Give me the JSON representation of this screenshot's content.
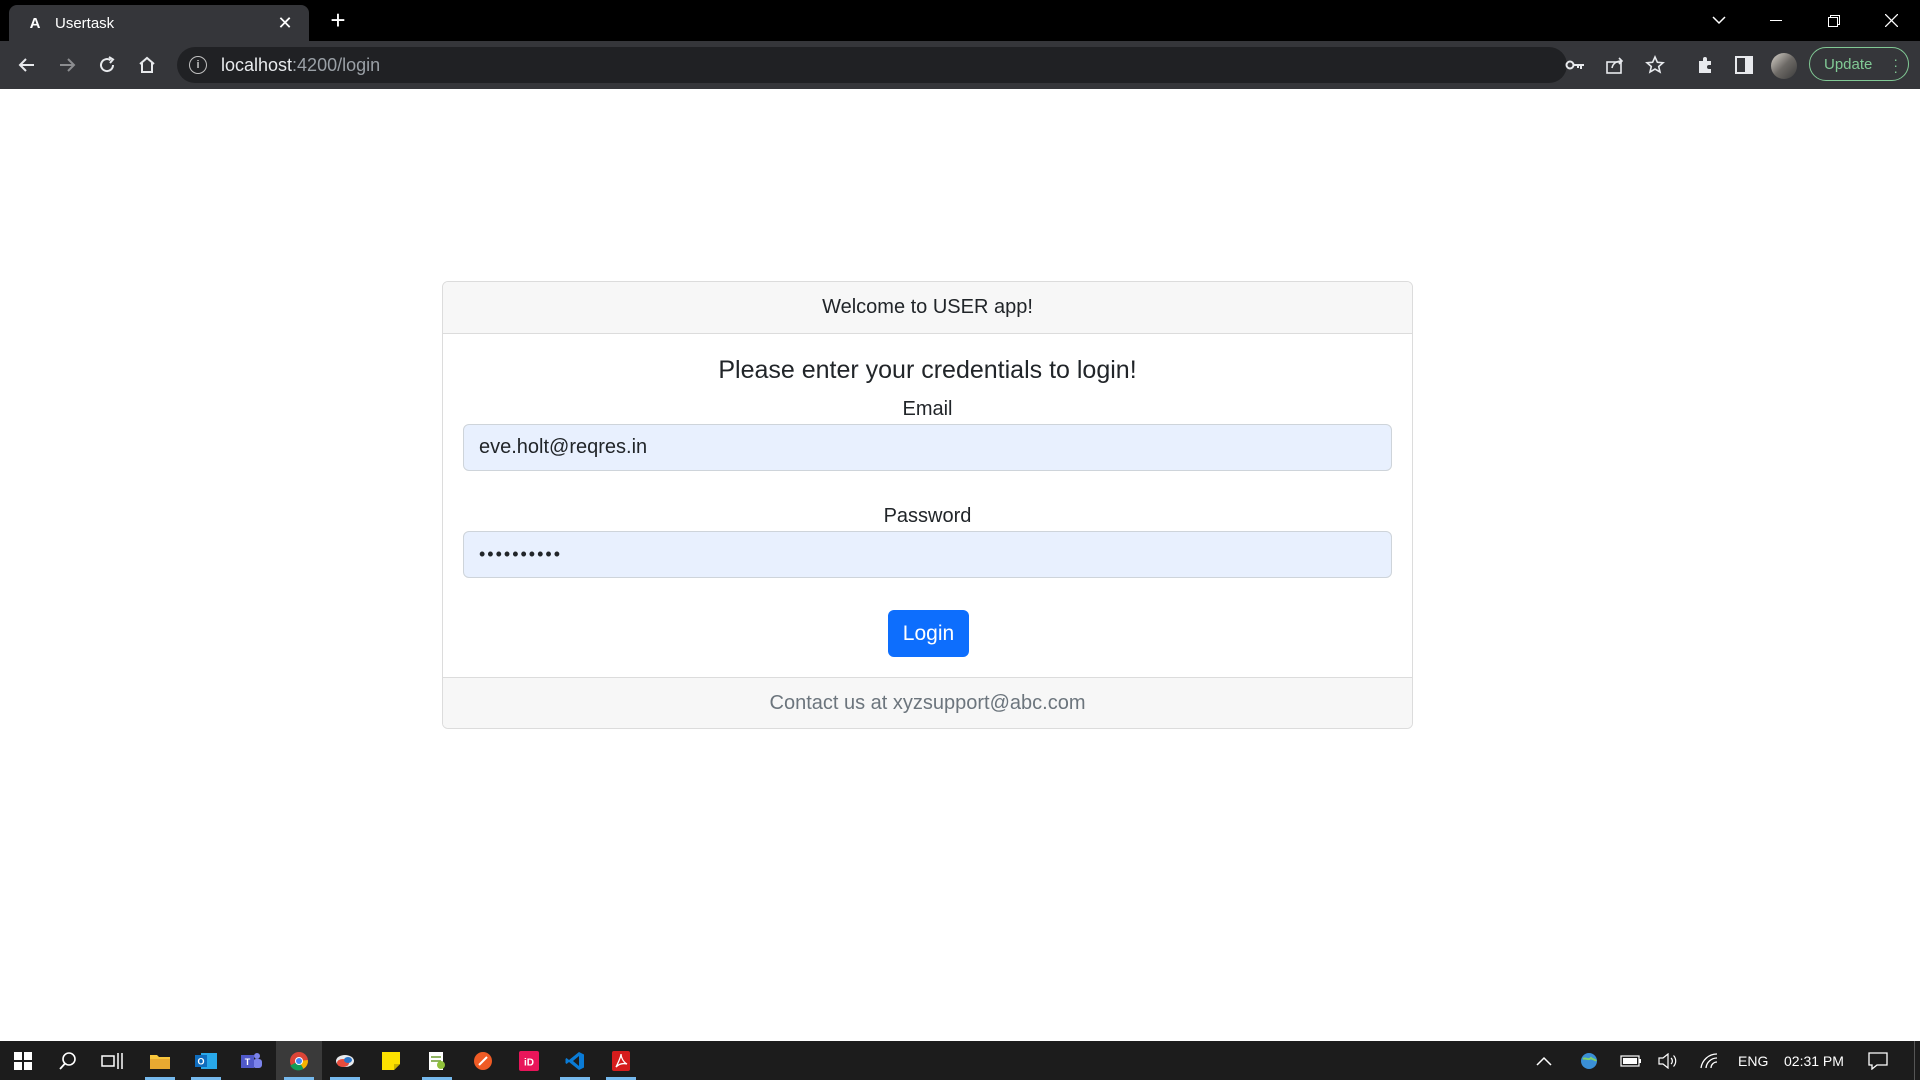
{
  "browser": {
    "tab": {
      "title": "Usertask",
      "favicon": "angular-logo-icon"
    },
    "address": {
      "host": "localhost",
      "path": ":4200/login"
    },
    "update_label": "Update"
  },
  "card": {
    "header": "Welcome to USER app!",
    "heading": "Please enter your credentials to login!",
    "email": {
      "label": "Email",
      "value": "eve.holt@reqres.in"
    },
    "password": {
      "label": "Password",
      "value": "••••••••••"
    },
    "login_label": "Login",
    "footer": "Contact us at xyzsupport@abc.com"
  },
  "taskbar": {
    "apps": [
      "file-explorer-icon",
      "outlook-icon",
      "teams-icon",
      "chrome-icon",
      "cloud-app-icon",
      "sticky-notes-icon",
      "notepad-plus-icon",
      "postman-icon",
      "indesign-icon",
      "vscode-icon",
      "acrobat-icon"
    ],
    "language": "ENG",
    "time": "02:31 PM"
  },
  "colors": {
    "primary": "#0d6efd",
    "autofill": "#e8f0fe",
    "chrome_dark": "#35363a"
  }
}
